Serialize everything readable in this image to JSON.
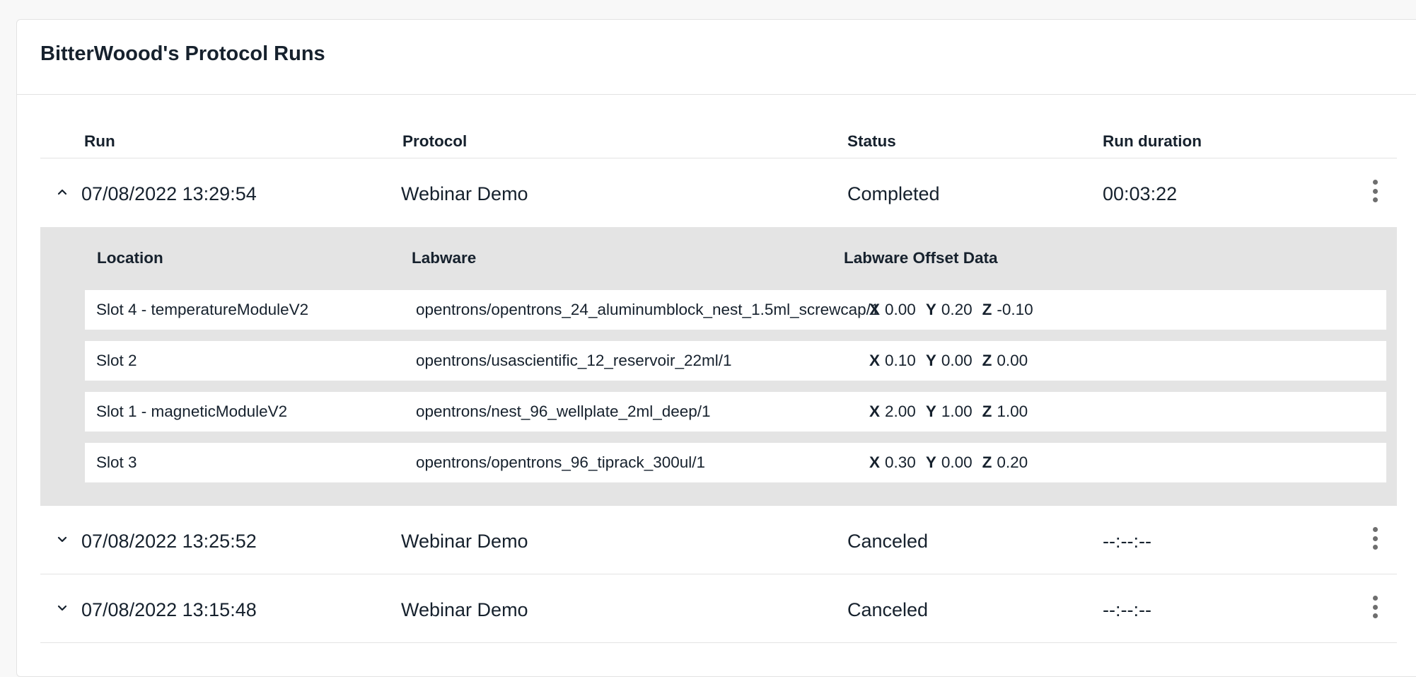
{
  "title": "BitterWoood's Protocol Runs",
  "columns": {
    "run": "Run",
    "protocol": "Protocol",
    "status": "Status",
    "duration": "Run duration"
  },
  "runs": [
    {
      "timestamp": "07/08/2022 13:29:54",
      "protocol": "Webinar Demo",
      "status": "Completed",
      "duration": "00:03:22",
      "expanded": true,
      "chevron": "chevron-up-icon"
    },
    {
      "timestamp": "07/08/2022 13:25:52",
      "protocol": "Webinar Demo",
      "status": "Canceled",
      "duration": "--:--:--",
      "expanded": false,
      "chevron": "chevron-down-icon"
    },
    {
      "timestamp": "07/08/2022 13:15:48",
      "protocol": "Webinar Demo",
      "status": "Canceled",
      "duration": "--:--:--",
      "expanded": false,
      "chevron": "chevron-down-icon"
    }
  ],
  "details": {
    "columns": {
      "location": "Location",
      "labware": "Labware",
      "offset": "Labware Offset Data"
    },
    "axes": {
      "x": "X",
      "y": "Y",
      "z": "Z"
    },
    "rows": [
      {
        "location": "Slot 4 - temperatureModuleV2",
        "labware": "opentrons/opentrons_24_aluminumblock_nest_1.5ml_screwcap/1",
        "x": "0.00",
        "y": "0.20",
        "z": "-0.10"
      },
      {
        "location": "Slot 2",
        "labware": "opentrons/usascientific_12_reservoir_22ml/1",
        "x": "0.10",
        "y": "0.00",
        "z": "0.00"
      },
      {
        "location": "Slot 1 - magneticModuleV2",
        "labware": "opentrons/nest_96_wellplate_2ml_deep/1",
        "x": "2.00",
        "y": "1.00",
        "z": "1.00"
      },
      {
        "location": "Slot 3",
        "labware": "opentrons/opentrons_96_tiprack_300ul/1",
        "x": "0.30",
        "y": "0.00",
        "z": "0.20"
      }
    ]
  },
  "icons": {
    "menu": "more-vertical-icon"
  },
  "colors": {
    "text": "#16212d",
    "divider": "#e3e3e3",
    "details_bg": "#e4e4e4",
    "icon": "#6e6e6e"
  }
}
